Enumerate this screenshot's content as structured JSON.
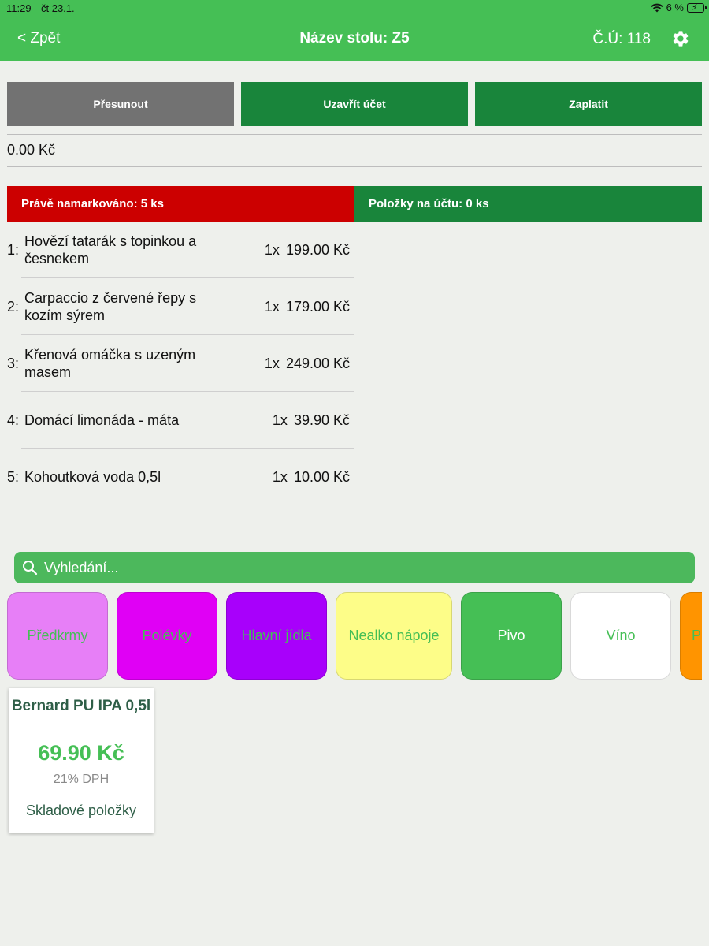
{
  "status_bar": {
    "time": "11:29",
    "date": "čt 23.1.",
    "battery_percent": "6 %"
  },
  "nav": {
    "back_label": "< Zpět",
    "title": "Název stolu: Z5",
    "account": "Č.Ú: 118"
  },
  "actions": {
    "move": "Přesunout",
    "close": "Uzavřít účet",
    "pay": "Zaplatit"
  },
  "total": "0.00 Kč",
  "sections": {
    "just_ordered": "Právě namarkováno: 5 ks",
    "on_bill": "Položky na účtu: 0 ks"
  },
  "orders": [
    {
      "num": "1:",
      "name": "Hovězí tatarák s topinkou a česnekem",
      "qty": "1x",
      "price": "199.00 Kč"
    },
    {
      "num": "2:",
      "name": "Carpaccio z červené řepy s kozím sýrem",
      "qty": "1x",
      "price": "179.00 Kč"
    },
    {
      "num": "3:",
      "name": "Křenová omáčka s uzeným masem",
      "qty": "1x",
      "price": "249.00 Kč"
    },
    {
      "num": "4:",
      "name": "Domácí limonáda - máta",
      "qty": "1x",
      "price": "39.90 Kč"
    },
    {
      "num": "5:",
      "name": "Kohoutková voda 0,5l",
      "qty": "1x",
      "price": "10.00 Kč"
    }
  ],
  "search": {
    "placeholder": "Vyhledání..."
  },
  "categories": [
    {
      "label": "Předkrmy",
      "bg": "#e77ff7",
      "fg": "#45bf55"
    },
    {
      "label": "Polévky",
      "bg": "#e000f5",
      "fg": "#45bf55"
    },
    {
      "label": "Hlavní jídla",
      "bg": "#a800fb",
      "fg": "#45bf55"
    },
    {
      "label": "Nealko nápoje",
      "bg": "#fdfd88",
      "fg": "#45bf55"
    },
    {
      "label": "Pivo",
      "bg": "#45bf55",
      "fg": "#ffffff"
    },
    {
      "label": "Víno",
      "bg": "#ffffff",
      "fg": "#45bf55"
    },
    {
      "label": "P",
      "bg": "#ff9400",
      "fg": "#45bf55"
    }
  ],
  "product": {
    "name": "Bernard PU IPA 0,5l",
    "price": "69.90 Kč",
    "vat": "21% DPH",
    "stock": "Skladové položky"
  }
}
